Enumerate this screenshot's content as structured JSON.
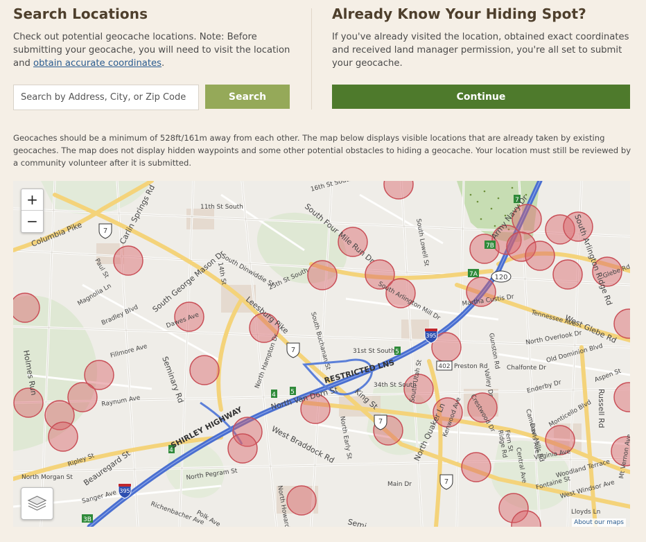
{
  "left": {
    "title": "Search Locations",
    "description_prefix": "Check out potential geocache locations. Note: Before submitting your geocache, you will need to visit the location and ",
    "description_link": "obtain accurate coordinates",
    "description_suffix": ".",
    "search_placeholder": "Search by Address, City, or Zip Code",
    "search_value": "",
    "search_button": "Search"
  },
  "right": {
    "title": "Already Know Your Hiding Spot?",
    "description": "If you've already visited the location, obtained exact coordinates and received land manager permission, you're all set to submit your geocache.",
    "continue_button": "Continue"
  },
  "notice": "Geocaches should be a minimum of 528ft/161m away from each other. The map below displays visible locations that are already taken by existing geocaches. The map does not display hidden waypoints and some other potential obstacles to hiding a geocache. Your location must still be reviewed by a community volunteer after it is submitted.",
  "map": {
    "zoom_in": "+",
    "zoom_out": "−",
    "about_link": "About our maps",
    "icons": {
      "layers": "layers-icon"
    },
    "colors": {
      "cache_circle": "#d9636a",
      "highway": "#4a6fd0",
      "major_road": "#f4d37a"
    },
    "street_labels": [
      "Columbia Pike",
      "Carlin Springs Rd",
      "South George Mason Dr",
      "Leesburg Pike",
      "South Four Mile Run Dr",
      "Army Navy Dr",
      "South Arlington Ridge Rd",
      "West Glebe Rd",
      "Seminary Rd",
      "SHIRLEY HIGHWAY",
      "RESTRICTED LNS",
      "North Van Dorn St",
      "West Braddock Rd",
      "King St",
      "North Quaker Ln",
      "Russell Rd",
      "Beauregard St",
      "Holmes Run",
      "South Lowell St",
      "Dawes Ave",
      "Fillmore Ave",
      "Bradley Blvd",
      "Magnolia Ln",
      "Paul St",
      "Preston Rd",
      "Chalfonte Dr",
      "Valley Dr",
      "Gunston Rd",
      "Martha Custis Dr",
      "Tennessee Ave",
      "North Overlook Dr",
      "Old Dominion Blvd",
      "Aspen St",
      "Enderby Dr",
      "Virginia Ave",
      "Woodland Terrace",
      "Fontaine St",
      "West Windsor Ave",
      "Lloyds Ln",
      "Main Dr",
      "North Pegram St",
      "Richenbacher Ave",
      "Polk Ave",
      "Sanger Ave",
      "North Morgan St",
      "Raynum Ave",
      "Ripley St",
      "South Arlington Mill Dr",
      "South Buchanan St",
      "31st St South",
      "34th St South",
      "South Dinwiddie St",
      "11th St South",
      "16th St South",
      "25th St South",
      "14th St",
      "North Hampton Dr",
      "North Howard St",
      "North Early St",
      "South Utah St",
      "Crestwood Dr",
      "Kenwood Ave",
      "Cameron Mills Rd",
      "Ridge Rd",
      "Central Ave",
      "Monticello Blvd",
      "Fern St",
      "Davis Ave",
      "Mt Vernon Ave",
      "Glebe Rd",
      "Semi"
    ],
    "route_shields": [
      "7",
      "7",
      "7",
      "7",
      "120",
      "395",
      "395",
      "402",
      "7A",
      "7B",
      "7",
      "3B",
      "4",
      "4",
      "5",
      "5"
    ]
  }
}
